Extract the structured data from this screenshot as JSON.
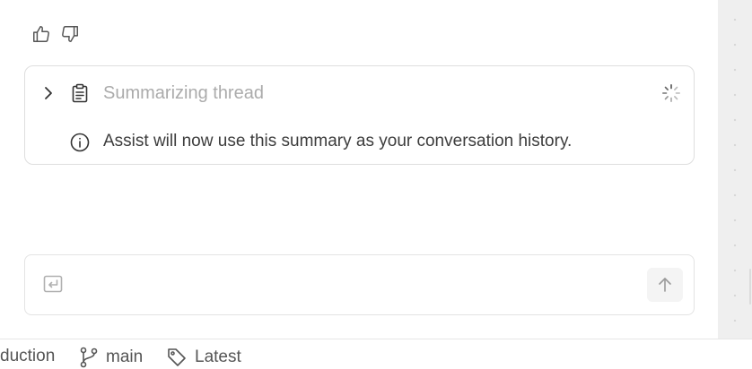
{
  "feedback": {
    "thumbs_up_icon": "thumbs-up-icon",
    "thumbs_down_icon": "thumbs-down-icon"
  },
  "summary_card": {
    "title": "Summarizing thread",
    "info_text": "Assist will now use this summary as your conversation history.",
    "expand_icon": "chevron-right-icon",
    "document_icon": "clipboard-icon",
    "status_icon": "spinner-icon",
    "info_icon": "info-icon"
  },
  "composer": {
    "value": "",
    "placeholder": "",
    "enter_icon": "enter-icon",
    "send_icon": "arrow-up-icon"
  },
  "status_bar": {
    "project_partial": "duction",
    "branch": "main",
    "version": "Latest",
    "branch_icon": "git-branch-icon",
    "tag_icon": "tag-icon"
  },
  "colors": {
    "muted_text": "#ababab",
    "body_text": "#3d3d3d",
    "border": "#dedede",
    "rail": "#efefef"
  }
}
